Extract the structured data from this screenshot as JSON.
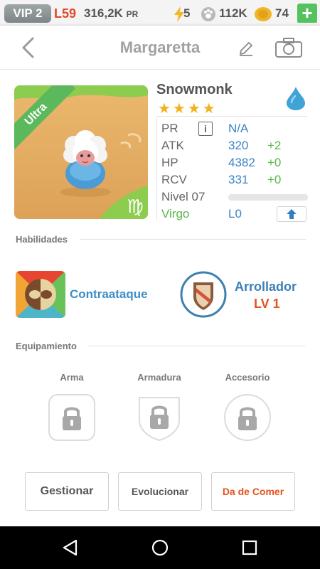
{
  "resources": {
    "vip": "VIP 2",
    "level": "L59",
    "power": "316,2K",
    "power_suffix": "PR",
    "energy": "5",
    "paws": "112K",
    "coins": "74",
    "add": "+"
  },
  "header": {
    "title": "Margaretta"
  },
  "pet": {
    "rarity": "Ultra",
    "name": "Snowmonk",
    "stars": "★★★★",
    "zodiac_symbol": "♍",
    "stats": {
      "pr_label": "PR",
      "pr_value": "N/A",
      "atk_label": "ATK",
      "atk_value": "320",
      "atk_bonus": "+2",
      "hp_label": "HP",
      "hp_value": "4382",
      "hp_bonus": "+0",
      "rcv_label": "RCV",
      "rcv_value": "331",
      "rcv_bonus": "+0",
      "level_label": "Nivel 07",
      "zodiac_label": "Virgo",
      "limit": "L0"
    },
    "xp_progress": 0
  },
  "skills": {
    "title": "Habilidades",
    "active_name": "Contraataque",
    "leader_name": "Arrollador",
    "leader_level": "LV 1"
  },
  "equipment": {
    "title": "Equipamiento",
    "slots": [
      "Arma",
      "Armadura",
      "Accesorio"
    ]
  },
  "actions": {
    "manage": "Gestionar",
    "evolve": "Evolucionar",
    "feed": "Da de Comer"
  },
  "colors": {
    "accent_blue": "#3b83c4",
    "bonus_green": "#56b646",
    "level_red": "#e0482b",
    "feed_orange": "#e3531b",
    "ultra_ribbon": "#5cb85c",
    "star_gold": "#f3b21d"
  }
}
